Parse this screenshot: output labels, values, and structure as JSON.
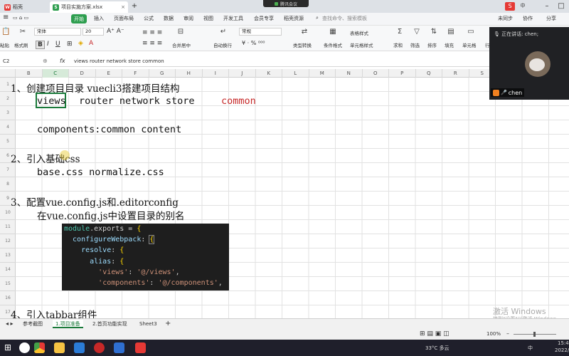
{
  "tabs": [
    {
      "label": "稻壳"
    },
    {
      "label": "项目实施方案.xlsx"
    }
  ],
  "meeting_pill": "腾讯会议",
  "menu": {
    "start": "开始",
    "items": [
      "插入",
      "页面布局",
      "公式",
      "数据",
      "审阅",
      "视图",
      "开发工具",
      "会员专享",
      "稻壳资源"
    ],
    "search": "查找命令、搜索模板",
    "sync": "未同步",
    "collab": "协作",
    "share": "分享"
  },
  "ribbon": {
    "paste": "粘贴",
    "format_painter": "格式刷",
    "cut": "剪切",
    "copy": "复制",
    "font": "宋体",
    "size": "20",
    "bold": "B",
    "italic": "I",
    "underline": "U",
    "merge": "合并居中",
    "wrap": "自动换行",
    "number_format": "常规",
    "type_convert": "类型转换",
    "cond_format": "条件格式",
    "table_style": "表格样式",
    "cell_style": "单元格样式",
    "sum": "求和",
    "filter": "筛选",
    "sort": "排序",
    "fill": "填充",
    "cell": "单元格",
    "row_col": "行"
  },
  "formula": {
    "name_box": "C2",
    "fx": "fx",
    "content": "views   router   network   store   common"
  },
  "columns": [
    "B",
    "C",
    "D",
    "E",
    "F",
    "G",
    "H",
    "I",
    "J",
    "K",
    "L",
    "M",
    "N",
    "O",
    "P",
    "Q",
    "R",
    "S"
  ],
  "rows": [
    "1",
    "2",
    "3",
    "4",
    "5",
    "6",
    "7",
    "8",
    "9",
    "10",
    "11",
    "12",
    "13",
    "14",
    "15",
    "16",
    "17"
  ],
  "sheet": {
    "line1": "1、创建项目目录    vuecli3搭建项目结构",
    "line2a": "views",
    "line2b": "router   network   store",
    "line2c": "common",
    "line3": "components:common  content",
    "line4": "2、引入基础css",
    "line5": "base.css  normalize.css",
    "line6": "3、配置vue.config.js和.editorconfig",
    "line7": "在vue.config.js中设置目录的别名",
    "line8": "4、引入tabbar组件"
  },
  "code": {
    "l1a": "module",
    "l1b": ".exports = ",
    "l1c": "{",
    "l2a": "  configureWebpack",
    ":": ": ",
    "l2c": "{",
    "l3a": "    resolve",
    "l4a": "      alias",
    "l5a": "'views'",
    "l5b": "'@/views'",
    "l6a": "'components'",
    "l6b": "'@/components'"
  },
  "sheet_tabs": [
    "参考截图",
    "1.项目准备",
    "2.首页功能实现",
    "Sheet3"
  ],
  "add_sheet": "+",
  "status": {
    "zoom": "100%"
  },
  "meeting": {
    "speaking": "正在讲话: chen;",
    "name": "chen"
  },
  "watermark": {
    "line1": "激活 Windows",
    "line2": "转到\"设置\"以激活 Windows。"
  },
  "taskbar": {
    "weather": "33°C 多云",
    "ime": "中",
    "time": "15:4",
    "date": "2022/"
  },
  "colors": {
    "accent": "#1a7a3a",
    "red_text": "#c62828"
  }
}
